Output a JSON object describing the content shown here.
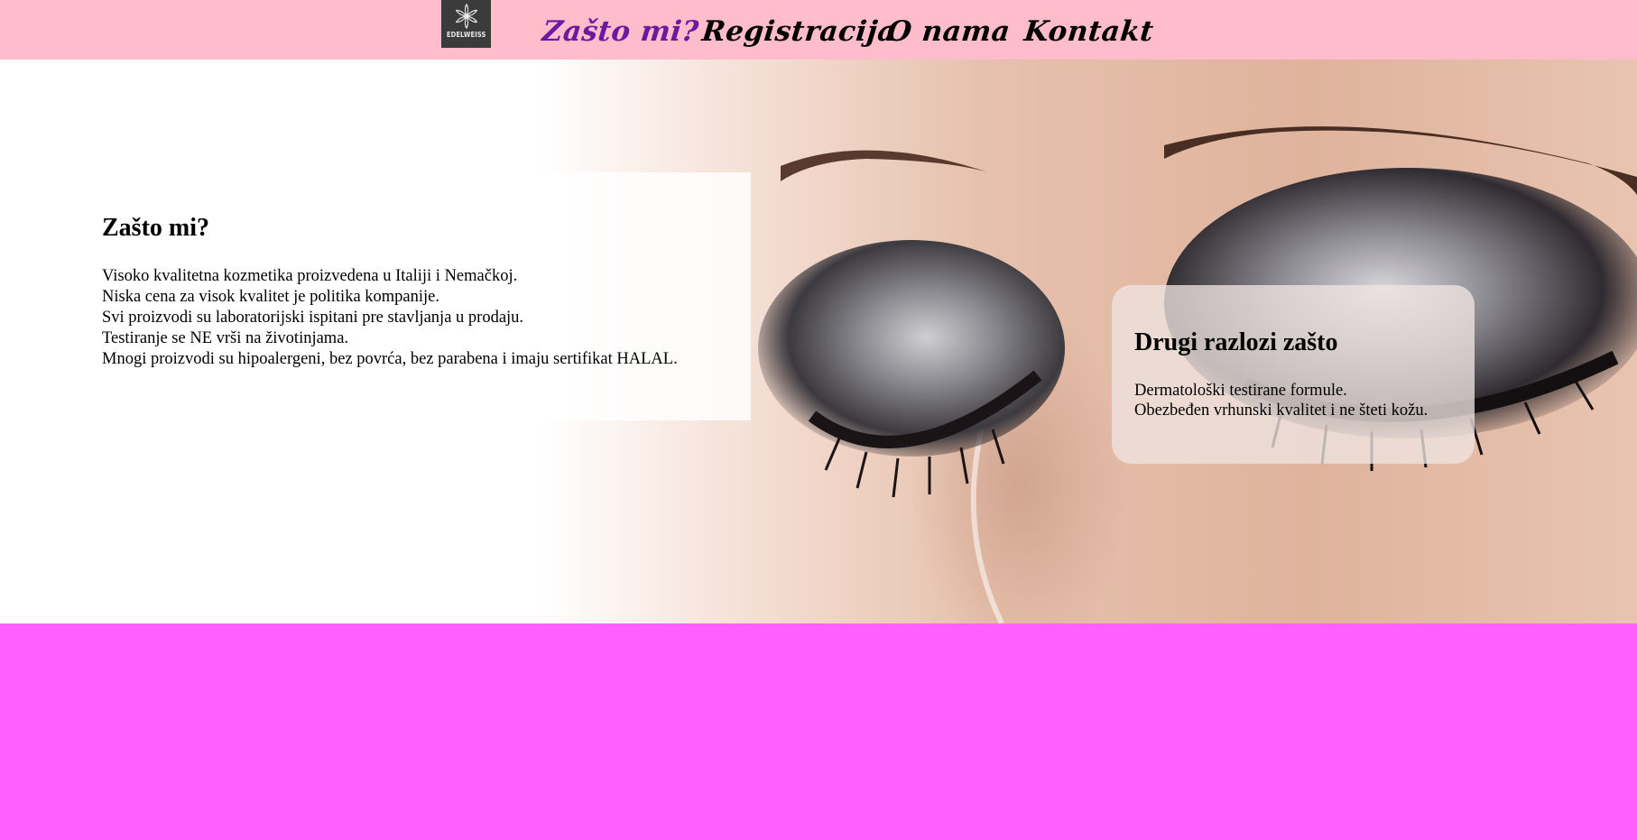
{
  "nav": {
    "logo_text": "EDELWEISS",
    "links": [
      {
        "label": "Zašto mi?",
        "active": true
      },
      {
        "label": "Registracija",
        "active": false
      },
      {
        "label": "O nama",
        "active": false
      },
      {
        "label": "Kontakt",
        "active": false
      }
    ]
  },
  "hero": {
    "image": "closed-eye-smoky-makeup-photo",
    "left_panel": {
      "title": "Zašto mi?",
      "lines": [
        "Visoko kvalitetna kozmetika proizvedena u Italiji i Nemačkoj.",
        "Niska cena za visok kvalitet je politika kompanije.",
        "Svi proizvodi su laboratorijski ispitani pre stavljanja u prodaju.",
        "Testiranje se NE vrši na životinjama.",
        "Mnogi proizvodi su hipoalergeni, bez povrća, bez parabena i imaju sertifikat HALAL."
      ]
    },
    "right_card": {
      "title": "Drugi razlozi zašto",
      "lines": [
        "Dermatološki testirane formule.",
        "Obezbeđen vrhunski kvalitet i ne šteti kožu."
      ]
    }
  },
  "colors": {
    "navbar_bg": "#ffbccb",
    "active_link": "#6b1aa0",
    "footer_bg": "#ff5fff",
    "logo_bg": "#3b3b3b"
  }
}
